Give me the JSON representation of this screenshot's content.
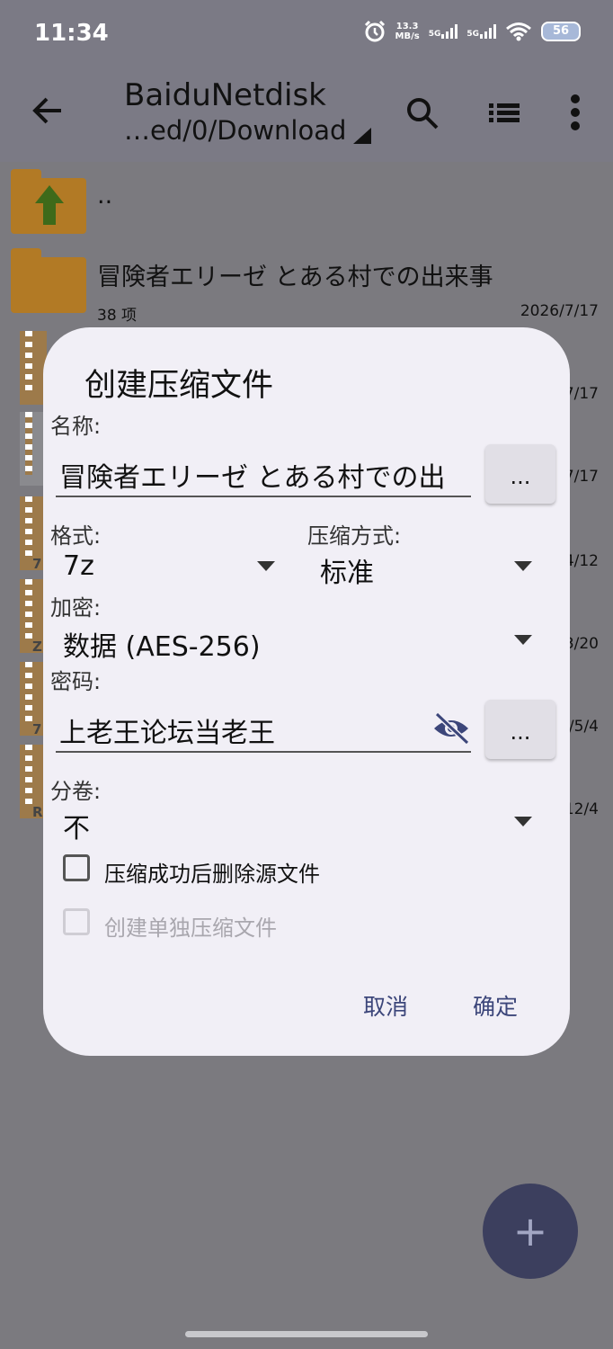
{
  "status_bar": {
    "time": "11:34",
    "net_speed_value": "13.3",
    "net_speed_unit": "MB/s",
    "sim1": "5G",
    "sim2": "5G",
    "battery": "56"
  },
  "app_bar": {
    "title": "BaiduNetdisk",
    "path": "…ed/0/Download"
  },
  "files": [
    {
      "name": "..",
      "meta": "",
      "date": ""
    },
    {
      "name": "冒険者エリーゼ とある村での出来事",
      "meta": "38 项",
      "date": "2026/7/17"
    }
  ],
  "bg_dates": [
    "7/17",
    "7/17",
    "4/12",
    "3/20",
    "/5/4",
    "12/4"
  ],
  "bg_letters": [
    "7",
    "Z",
    "7",
    "R"
  ],
  "dialog": {
    "title": "创建压缩文件",
    "name_label": "名称:",
    "name_value": "冒険者エリーゼ とある村での出",
    "more_button": "...",
    "format_label": "格式:",
    "format_value": "7z",
    "method_label": "压缩方式:",
    "method_value": "标准",
    "encryption_label": "加密:",
    "encryption_value": "数据 (AES-256)",
    "password_label": "密码:",
    "password_value": "上老王论坛当老王",
    "volume_label": "分卷:",
    "volume_value": "不",
    "delete_source_label": "压缩成功后删除源文件",
    "separate_archives_label": "创建单独压缩文件",
    "cancel": "取消",
    "ok": "确定"
  },
  "fab": {
    "label": "+"
  }
}
